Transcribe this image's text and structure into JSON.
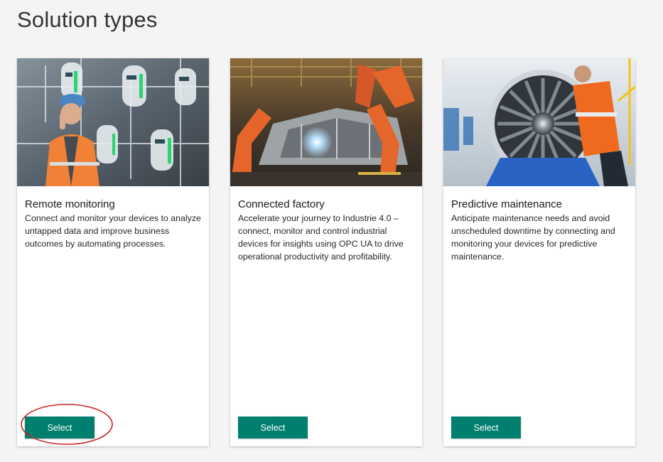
{
  "page": {
    "title": "Solution types"
  },
  "solutions": [
    {
      "title": "Remote monitoring",
      "description": "Connect and monitor your devices to analyze untapped data and improve business outcomes by automating processes.",
      "button_label": "Select",
      "highlighted": true
    },
    {
      "title": "Connected factory",
      "description": "Accelerate your journey to Industrie 4.0 – connect, monitor and control industrial devices for insights using OPC UA to drive operational productivity and profitability.",
      "button_label": "Select",
      "highlighted": false
    },
    {
      "title": "Predictive maintenance",
      "description": "Anticipate maintenance needs and avoid unscheduled downtime by connecting and monitoring your devices for predictive maintenance.",
      "button_label": "Select",
      "highlighted": false
    }
  ],
  "colors": {
    "background": "#f4f4f4",
    "card": "#ffffff",
    "button": "#007f6e",
    "annotation": "#cc2222"
  }
}
